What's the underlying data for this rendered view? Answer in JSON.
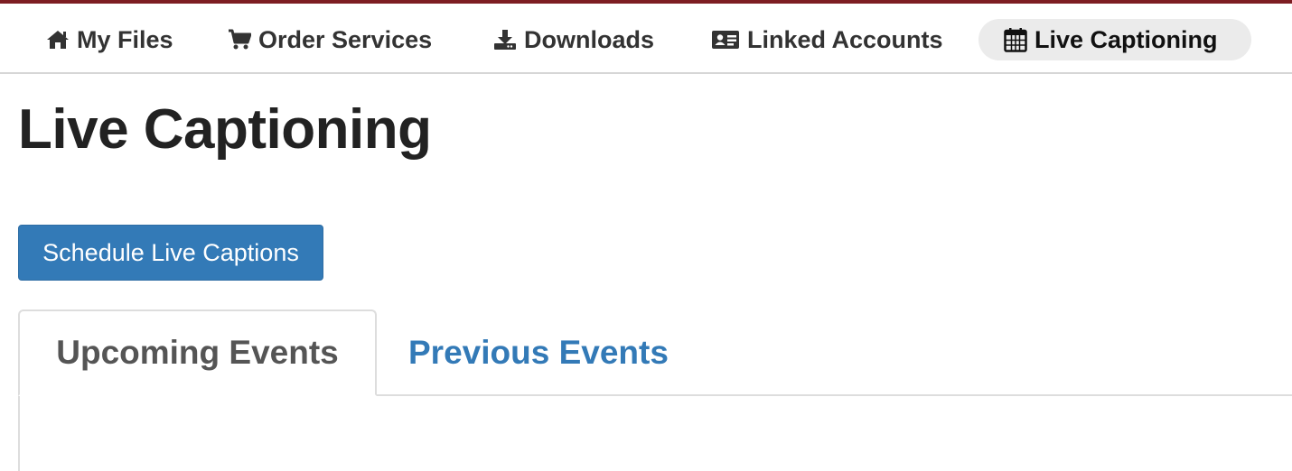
{
  "nav": {
    "items": [
      {
        "label": "My Files",
        "icon": "home-icon"
      },
      {
        "label": "Order Services",
        "icon": "cart-icon"
      },
      {
        "label": "Downloads",
        "icon": "download-icon"
      },
      {
        "label": "Linked Accounts",
        "icon": "id-card-icon"
      },
      {
        "label": "Live Captioning",
        "icon": "calendar-icon",
        "active": true
      }
    ]
  },
  "page": {
    "title": "Live Captioning"
  },
  "actions": {
    "schedule_label": "Schedule Live Captions"
  },
  "tabs": [
    {
      "label": "Upcoming Events",
      "active": true
    },
    {
      "label": "Previous Events",
      "active": false
    }
  ],
  "colors": {
    "top_bar": "#7d1d22",
    "primary": "#337ab7",
    "active_nav_bg": "#ebebeb"
  }
}
